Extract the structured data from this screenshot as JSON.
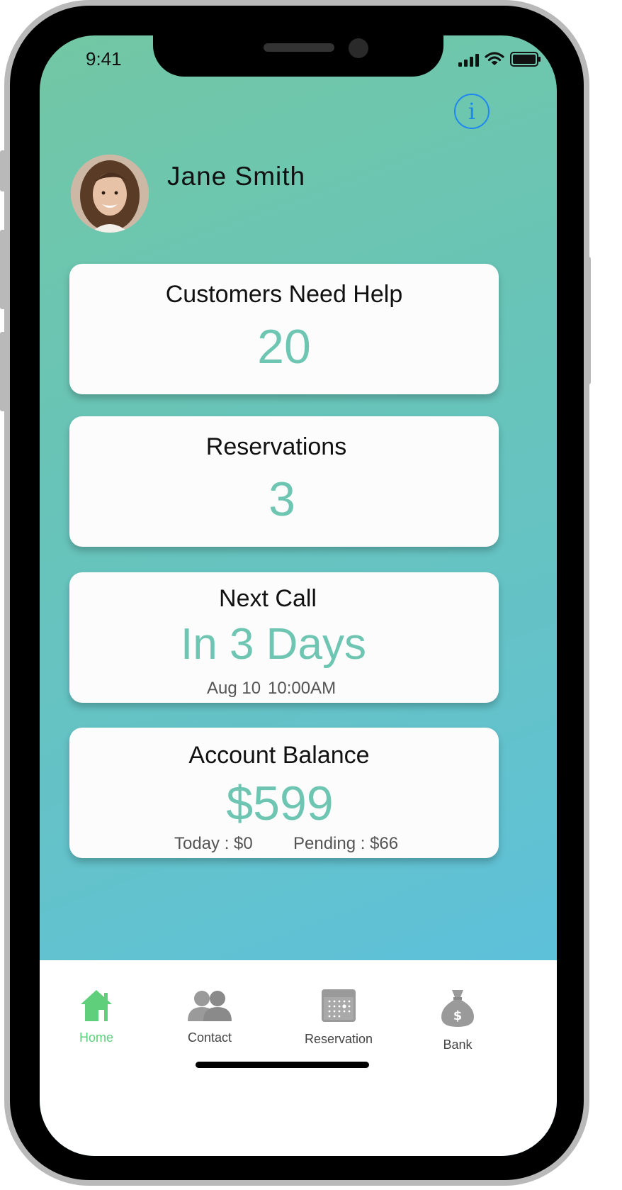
{
  "status_bar": {
    "time": "9:41"
  },
  "profile": {
    "name": "Jane Smith"
  },
  "cards": {
    "customers_need_help": {
      "title": "Customers Need Help",
      "value": "20"
    },
    "reservations": {
      "title": "Reservations",
      "value": "3"
    },
    "next_call": {
      "title": "Next Call",
      "value": "In 3 Days",
      "date": "Aug 10",
      "time": "10:00AM"
    },
    "account_balance": {
      "title": "Account Balance",
      "value": "$599",
      "today": "Today : $0",
      "pending": "Pending : $66"
    }
  },
  "tabbar": {
    "items": [
      {
        "label": "Home",
        "icon": "home-icon",
        "active": true
      },
      {
        "label": "Contact",
        "icon": "contacts-icon",
        "active": false
      },
      {
        "label": "Reservation",
        "icon": "calendar-icon",
        "active": false
      },
      {
        "label": "Bank",
        "icon": "money-bag-icon",
        "active": false
      }
    ]
  },
  "colors": {
    "accent_value": "#6ec6b2",
    "active_tab": "#5fcf7c",
    "info_icon": "#1e87f0",
    "gradient_start": "#72c7a4",
    "gradient_end": "#5ac0e6"
  }
}
